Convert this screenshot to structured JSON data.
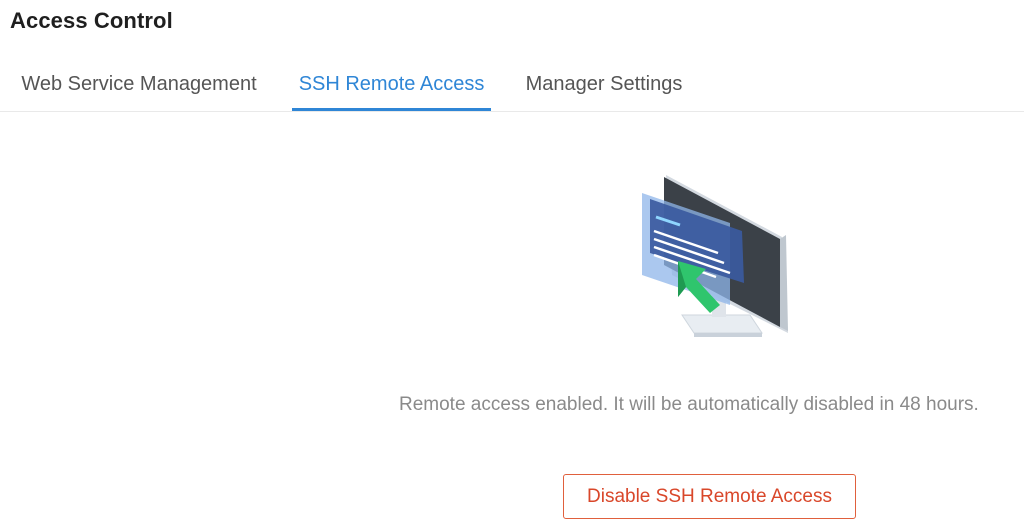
{
  "header": {
    "title": "Access Control"
  },
  "tabs": [
    {
      "label": "Web Service Management",
      "active": false
    },
    {
      "label": "SSH Remote Access",
      "active": true
    },
    {
      "label": "Manager Settings",
      "active": false
    }
  ],
  "ssh": {
    "illustration_icon": "monitor-with-cursor-icon",
    "status_message": "Remote access enabled. It will be automatically disabled in 48 hours.",
    "disable_button_label": "Disable SSH Remote Access"
  },
  "colors": {
    "accent": "#2f86d6",
    "danger": "#d9472a",
    "arrow": "#2fc56d",
    "monitor": "#3b4148"
  }
}
